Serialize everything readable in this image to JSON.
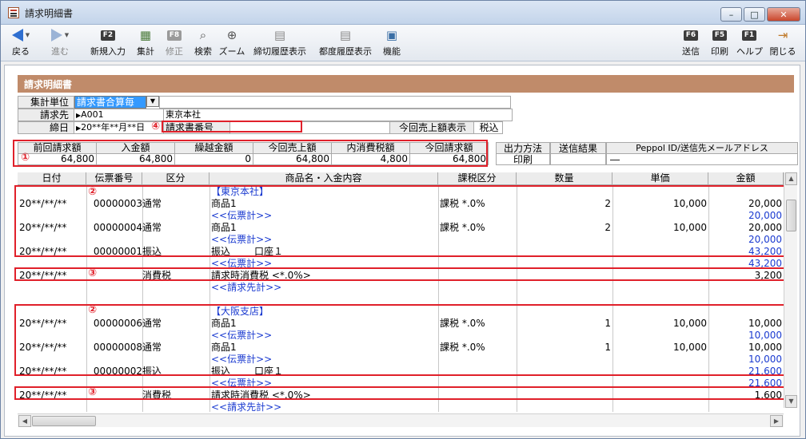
{
  "window": {
    "title": "請求明細書",
    "minimize": "–",
    "maximize": "□",
    "close": "✕"
  },
  "toolbar": {
    "back": "戻る",
    "forward": "進む",
    "new_entry_key": "F2",
    "new_entry": "新規入力",
    "total": "集計",
    "edit_key": "F8",
    "edit": "修正",
    "search": "検索",
    "zoom": "ズーム",
    "closing_history": "締切履歴表示",
    "each_history": "都度履歴表示",
    "function": "機能",
    "send_key": "F6",
    "send": "送信",
    "print_key": "F5",
    "print": "印刷",
    "help_key": "F1",
    "help": "ヘルプ",
    "close": "閉じる"
  },
  "banner": "請求明細書",
  "header": {
    "unit_label": "集計単位",
    "unit_value": "請求書合算毎",
    "dest_label": "請求先",
    "dest_code": "A001",
    "dest_name": "東京本社",
    "close_label": "締日",
    "close_value": "20**年**月**日",
    "invoice_no_label": "請求書番号",
    "display_label": "今回売上額表示",
    "display_value": "税込"
  },
  "summary": {
    "headers": [
      "前回請求額",
      "入金額",
      "繰越金額",
      "今回売上額",
      "内消費税額",
      "今回請求額"
    ],
    "values": [
      "64,800",
      "64,800",
      "0",
      "64,800",
      "4,800",
      "64,800"
    ]
  },
  "output": {
    "method_label": "出力方法",
    "method_value": "印刷",
    "result_label": "送信結果",
    "result_value": "",
    "peppol_label": "Peppol ID/送信先メールアドレス",
    "peppol_value": "―"
  },
  "markers": [
    "①",
    "②",
    "③",
    "④"
  ],
  "grid": {
    "columns": [
      "日付",
      "伝票番号",
      "区分",
      "商品名・入金内容",
      "課税区分",
      "数量",
      "単価",
      "金額"
    ],
    "rows": [
      {
        "name": "【東京本社】",
        "blue": true
      },
      {
        "date": "20**/**/**",
        "slip": "00000003",
        "kind": "通常",
        "name": "商品1",
        "tax": "課税 *.0%",
        "qty": "2",
        "price": "10,000",
        "amount": "20,000"
      },
      {
        "name": "<<伝票計>>",
        "amount": "20,000",
        "blue": true
      },
      {
        "date": "20**/**/**",
        "slip": "00000004",
        "kind": "通常",
        "name": "商品1",
        "tax": "課税 *.0%",
        "qty": "2",
        "price": "10,000",
        "amount": "20,000"
      },
      {
        "name": "<<伝票計>>",
        "amount": "20,000",
        "blue": true
      },
      {
        "date": "20**/**/**",
        "slip": "00000001",
        "kind": "振込",
        "name": "振込",
        "account": "口座１",
        "amount": "43,200",
        "amount_blue": true
      },
      {
        "name": "<<伝票計>>",
        "amount": "43,200",
        "blue": true
      },
      {
        "date": "20**/**/**",
        "kind": "消費税",
        "name": "請求時消費税 <*.0%>",
        "amount": "3,200"
      },
      {
        "name": "<<請求先計>>",
        "blue": true
      },
      {
        "name": ""
      },
      {
        "name": "【大阪支店】",
        "blue": true
      },
      {
        "date": "20**/**/**",
        "slip": "00000006",
        "kind": "通常",
        "name": "商品1",
        "tax": "課税 *.0%",
        "qty": "1",
        "price": "10,000",
        "amount": "10,000"
      },
      {
        "name": "<<伝票計>>",
        "amount": "10,000",
        "blue": true
      },
      {
        "date": "20**/**/**",
        "slip": "00000008",
        "kind": "通常",
        "name": "商品1",
        "tax": "課税 *.0%",
        "qty": "1",
        "price": "10,000",
        "amount": "10,000"
      },
      {
        "name": "<<伝票計>>",
        "amount": "10,000",
        "blue": true
      },
      {
        "date": "20**/**/**",
        "slip": "00000002",
        "kind": "振込",
        "name": "振込",
        "account": "口座１",
        "amount": "21,600",
        "amount_blue": true
      },
      {
        "name": "<<伝票計>>",
        "amount": "21,600",
        "blue": true
      },
      {
        "date": "20**/**/**",
        "kind": "消費税",
        "name": "請求時消費税 <*.0%>",
        "amount": "1,600"
      },
      {
        "name": "<<請求先計>>",
        "blue": true
      }
    ]
  },
  "colors": {
    "banner": "#c08b6a",
    "highlight": "#e0202a",
    "link": "#1a3ad0",
    "select": "#3399ff"
  }
}
